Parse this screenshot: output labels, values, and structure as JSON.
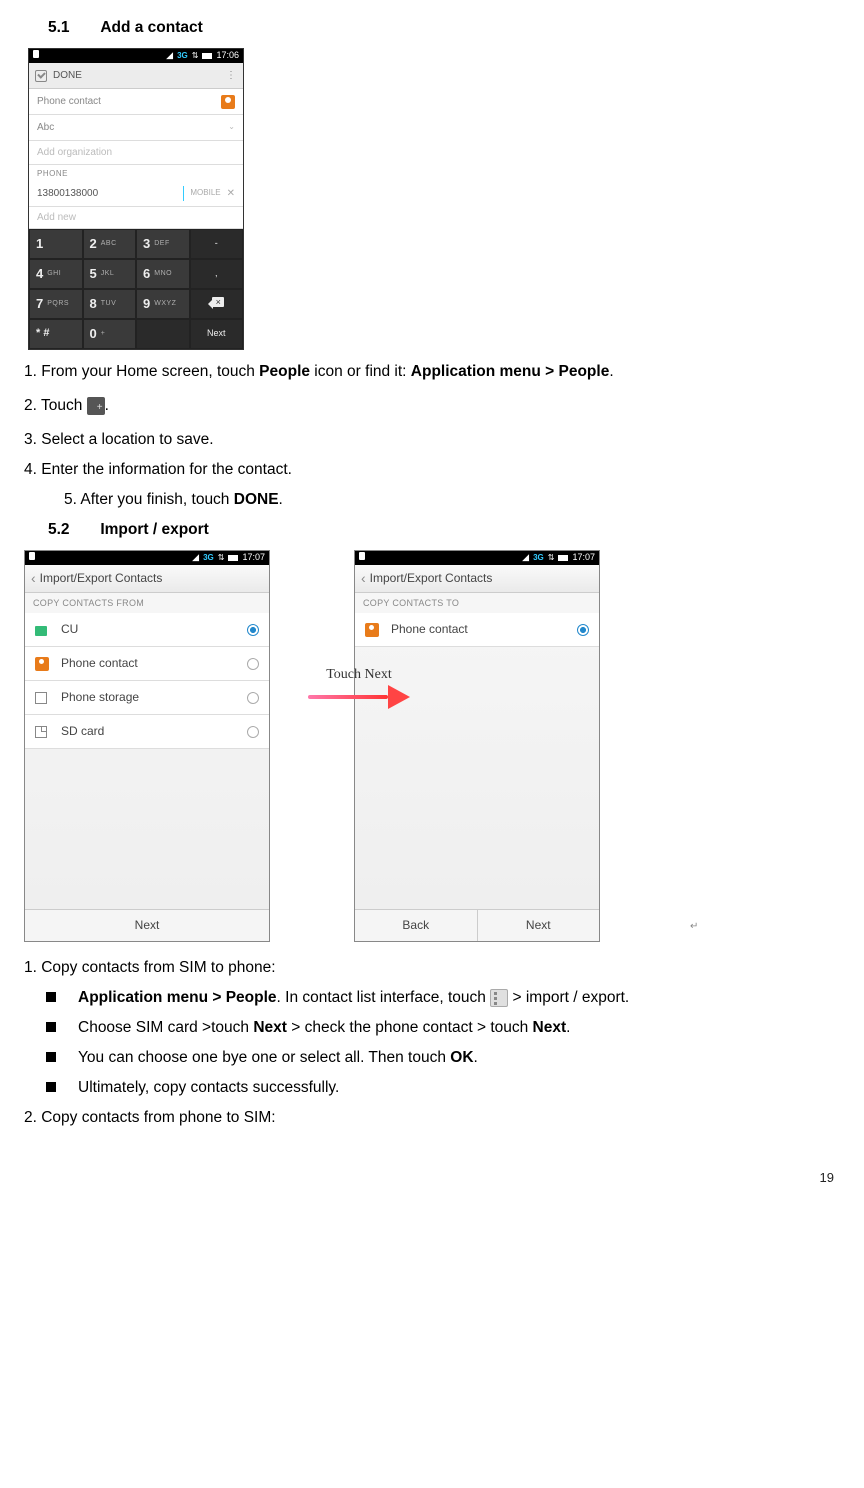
{
  "section51": {
    "num": "5.1",
    "title": "Add a contact"
  },
  "section52": {
    "num": "5.2",
    "title": "Import / export"
  },
  "screenshot1": {
    "status_time": "17:06",
    "status_net": "3G",
    "done": "DONE",
    "phone_contact": "Phone contact",
    "name": "Abc",
    "add_org": "Add organization",
    "phone_label": "PHONE",
    "phone_number": "13800138000",
    "mobile": "MOBILE",
    "add_new": "Add new",
    "keys": {
      "k1": "1",
      "k2m": "2",
      "k2s": "ABC",
      "k3m": "3",
      "k3s": "DEF",
      "k4m": "4",
      "k4s": "GHI",
      "k5m": "5",
      "k5s": "JKL",
      "k6m": "6",
      "k6s": "MNO",
      "k7m": "7",
      "k7s": "PQRS",
      "k8m": "8",
      "k8s": "TUV",
      "k9m": "9",
      "k9s": "WXYZ",
      "kstar": "* #",
      "k0m": "0",
      "k0s": "+",
      "next": "Next",
      "dash": "-",
      "dot": ","
    }
  },
  "instructions51": {
    "p1a": "1. From your Home screen, touch ",
    "p1b": "People",
    "p1c": " icon or find it: ",
    "p1d": "Application menu > People",
    "p1e": ".",
    "p2a": "2. Touch ",
    "p2b": ".",
    "p3": "3. Select a location to save.",
    "p4": "4. Enter the information for the contact.",
    "p5a": "5. After you finish, touch ",
    "p5b": "DONE",
    "p5c": "."
  },
  "screenshot2": {
    "status_time": "17:07",
    "status_net": "3G",
    "title": "Import/Export Contacts",
    "subtitle_from": "COPY CONTACTS FROM",
    "subtitle_to": "COPY CONTACTS TO",
    "rows_from": [
      "CU",
      "Phone contact",
      "Phone storage",
      "SD card"
    ],
    "rows_to": [
      "Phone contact"
    ],
    "next": "Next",
    "back": "Back",
    "touch_next": "Touch Next"
  },
  "instructions52": {
    "p1": "1. Copy contacts from SIM to phone:",
    "b1a": "Application menu > People",
    "b1b": ". In contact list interface, touch ",
    "b1c": " > import / export.",
    "b2a": "Choose SIM card >touch ",
    "b2b": "Next",
    "b2b2": " > check the phone contact > touch ",
    "b2c": "Next",
    "b2d": ".",
    "b3a": "You can choose one bye one or select all. Then touch ",
    "b3b": "OK",
    "b3c": ".",
    "b4": "Ultimately, copy contacts successfully.",
    "p2": "2. Copy contacts from phone to SIM:"
  },
  "page_number": "19"
}
